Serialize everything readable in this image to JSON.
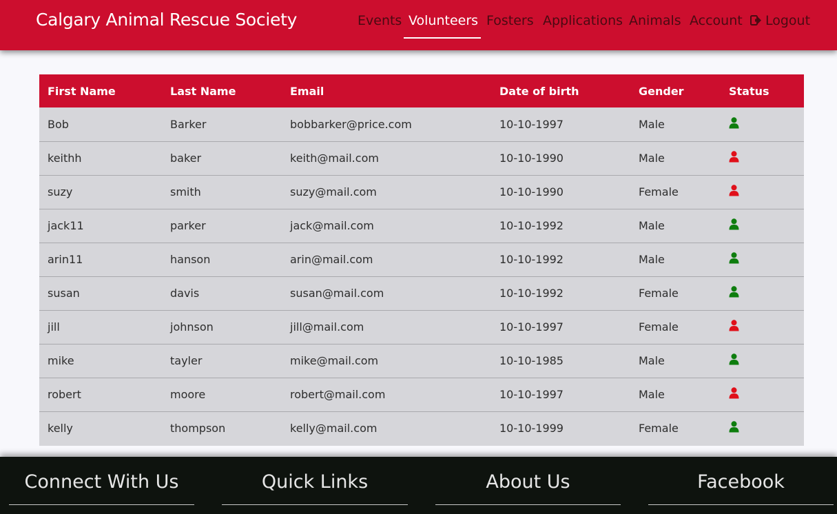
{
  "navbar": {
    "brand": "Calgary Animal Rescue Society",
    "items": [
      {
        "label": "Events"
      },
      {
        "label": "Volunteers"
      },
      {
        "label": "Fosters"
      },
      {
        "label": "Applications"
      },
      {
        "label": "Animals"
      },
      {
        "label": "Account"
      },
      {
        "label": "Logout"
      }
    ],
    "active": "Volunteers"
  },
  "table": {
    "headers": [
      "First Name",
      "Last Name",
      "Email",
      "Date of birth",
      "Gender",
      "Status"
    ],
    "rows": [
      {
        "first": "Bob",
        "last": "Barker",
        "email": "bobbarker@price.com",
        "dob": "10-10-1997",
        "gender": "Male",
        "status": "active"
      },
      {
        "first": "keithh",
        "last": "baker",
        "email": "keith@mail.com",
        "dob": "10-10-1990",
        "gender": "Male",
        "status": "inactive"
      },
      {
        "first": "suzy",
        "last": "smith",
        "email": "suzy@mail.com",
        "dob": "10-10-1990",
        "gender": "Female",
        "status": "inactive"
      },
      {
        "first": "jack11",
        "last": "parker",
        "email": "jack@mail.com",
        "dob": "10-10-1992",
        "gender": "Male",
        "status": "active"
      },
      {
        "first": "arin11",
        "last": "hanson",
        "email": "arin@mail.com",
        "dob": "10-10-1992",
        "gender": "Male",
        "status": "active"
      },
      {
        "first": "susan",
        "last": "davis",
        "email": "susan@mail.com",
        "dob": "10-10-1992",
        "gender": "Female",
        "status": "active"
      },
      {
        "first": "jill",
        "last": "johnson",
        "email": "jill@mail.com",
        "dob": "10-10-1997",
        "gender": "Female",
        "status": "inactive"
      },
      {
        "first": "mike",
        "last": "tayler",
        "email": "mike@mail.com",
        "dob": "10-10-1985",
        "gender": "Male",
        "status": "active"
      },
      {
        "first": "robert",
        "last": "moore",
        "email": "robert@mail.com",
        "dob": "10-10-1997",
        "gender": "Male",
        "status": "inactive"
      },
      {
        "first": "kelly",
        "last": "thompson",
        "email": "kelly@mail.com",
        "dob": "10-10-1999",
        "gender": "Female",
        "status": "active"
      }
    ],
    "status_icon": "user-icon",
    "status_colors": {
      "active": "#0e7d0e",
      "inactive": "#e0101a"
    }
  },
  "footer": {
    "columns": [
      "Connect With Us",
      "Quick Links",
      "About Us",
      "Facebook"
    ]
  },
  "colors": {
    "brand": "#cc0e2e",
    "footer_bg": "#0e130e",
    "table_bg": "#d6d6da"
  }
}
